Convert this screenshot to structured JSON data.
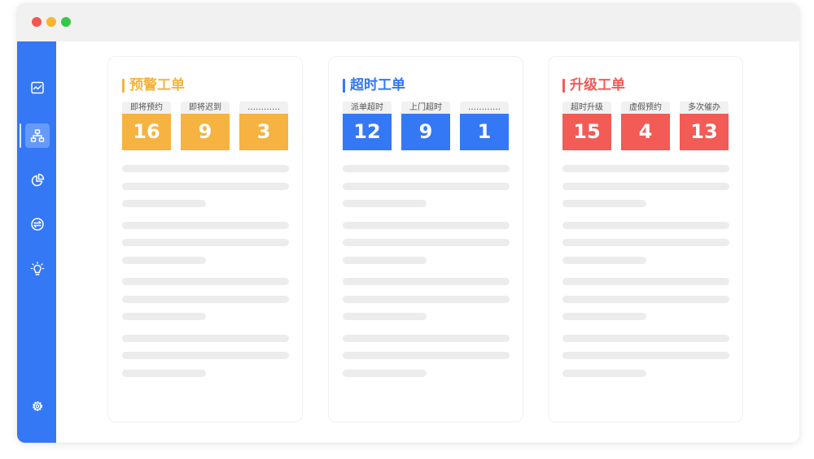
{
  "window": {
    "controls": [
      "close",
      "minimize",
      "maximize"
    ]
  },
  "sidebar": {
    "color": "#3478f6",
    "items": [
      {
        "icon": "activity-chart-icon",
        "active": false
      },
      {
        "icon": "hierarchy-icon",
        "active": true
      },
      {
        "icon": "pie-chart-icon",
        "active": false
      },
      {
        "icon": "transfer-icon",
        "active": false
      },
      {
        "icon": "lightbulb-icon",
        "active": false
      },
      {
        "icon": "gear-icon",
        "active": false
      }
    ]
  },
  "cards": [
    {
      "title": "预警工单",
      "color": "#f6b342",
      "stats": [
        {
          "label": "即将预约",
          "value": "16"
        },
        {
          "label": "即将迟到",
          "value": "9"
        },
        {
          "label": "…………",
          "value": "3"
        }
      ]
    },
    {
      "title": "超时工单",
      "color": "#3478f6",
      "stats": [
        {
          "label": "派单超时",
          "value": "12"
        },
        {
          "label": "上门超时",
          "value": "9"
        },
        {
          "label": "…………",
          "value": "1"
        }
      ]
    },
    {
      "title": "升级工单",
      "color": "#f25b56",
      "stats": [
        {
          "label": "超时升级",
          "value": "15"
        },
        {
          "label": "虚假预约",
          "value": "4"
        },
        {
          "label": "多次催办",
          "value": "13"
        }
      ]
    }
  ]
}
